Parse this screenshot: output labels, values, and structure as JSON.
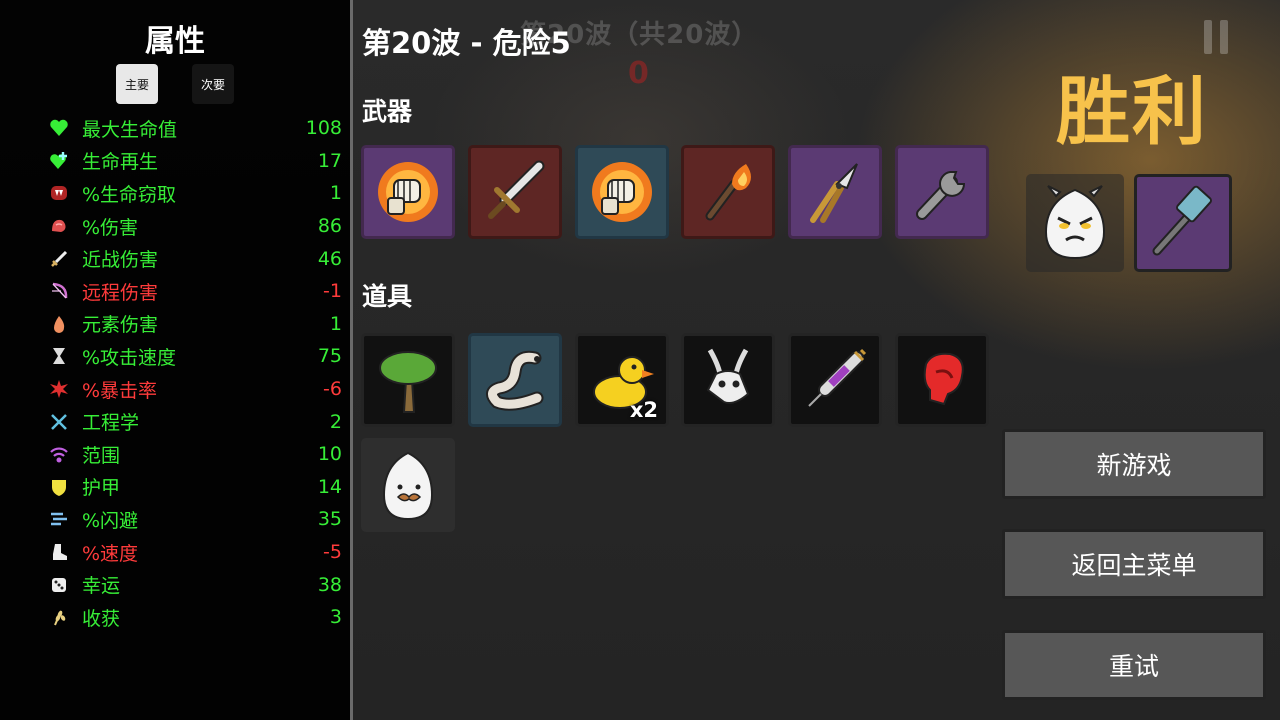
{
  "background": {
    "ghost_text": "第20波（共20波）",
    "ghost_number": "0"
  },
  "stats": {
    "title": "属性",
    "tabs": [
      {
        "label": "主要"
      },
      {
        "label": "次要"
      }
    ],
    "items": [
      {
        "label": "最大生命值",
        "value": "108",
        "tone": "pos",
        "icon": "heart-icon",
        "color": "#37ee37"
      },
      {
        "label": "生命再生",
        "value": "17",
        "tone": "pos",
        "icon": "heart-plus-icon",
        "color": "#37ee37"
      },
      {
        "label": "%生命窃取",
        "value": "1",
        "tone": "pos",
        "icon": "fangs-icon",
        "color": "#d03030"
      },
      {
        "label": "%伤害",
        "value": "86",
        "tone": "pos",
        "icon": "muscle-icon",
        "color": "#e05050"
      },
      {
        "label": "近战伤害",
        "value": "46",
        "tone": "pos",
        "icon": "sword-icon",
        "color": "#e8d8a0"
      },
      {
        "label": "远程伤害",
        "value": "-1",
        "tone": "neg",
        "icon": "bow-icon",
        "color": "#d070d0"
      },
      {
        "label": "元素伤害",
        "value": "1",
        "tone": "pos",
        "icon": "flame-icon",
        "color": "#f09060"
      },
      {
        "label": "%攻击速度",
        "value": "75",
        "tone": "pos",
        "icon": "hourglass-icon",
        "color": "#dddddd"
      },
      {
        "label": "%暴击率",
        "value": "-6",
        "tone": "neg",
        "icon": "crit-icon",
        "color": "#e03030"
      },
      {
        "label": "工程学",
        "value": "2",
        "tone": "pos",
        "icon": "crossed-tools-icon",
        "color": "#60c0e0"
      },
      {
        "label": "范围",
        "value": "10",
        "tone": "pos",
        "icon": "range-icon",
        "color": "#c060e0"
      },
      {
        "label": "护甲",
        "value": "14",
        "tone": "pos",
        "icon": "shield-icon",
        "color": "#f0e040"
      },
      {
        "label": "%闪避",
        "value": "35",
        "tone": "pos",
        "icon": "dash-icon",
        "color": "#80c0f0"
      },
      {
        "label": "%速度",
        "value": "-5",
        "tone": "neg",
        "icon": "boot-icon",
        "color": "#eeeeee"
      },
      {
        "label": "幸运",
        "value": "38",
        "tone": "pos",
        "icon": "dice-icon",
        "color": "#eeeeee"
      },
      {
        "label": "收获",
        "value": "3",
        "tone": "pos",
        "icon": "wheat-icon",
        "color": "#e8d080"
      }
    ]
  },
  "main": {
    "wave_title": "第20波 - 危险5",
    "weapons_label": "武器",
    "items_label": "道具",
    "weapons": [
      {
        "name": "fiery-fist-icon",
        "tier": "purple"
      },
      {
        "name": "sword-icon",
        "tier": "red"
      },
      {
        "name": "fiery-fist-icon",
        "tier": "blue"
      },
      {
        "name": "torch-icon",
        "tier": "red"
      },
      {
        "name": "pruner-icon",
        "tier": "purple"
      },
      {
        "name": "wrench-icon",
        "tier": "purple"
      }
    ],
    "items": [
      {
        "name": "tree-icon",
        "tier": "black"
      },
      {
        "name": "worm-icon",
        "tier": "blue"
      },
      {
        "name": "rubber-duck-icon",
        "tier": "black",
        "qty": "x2"
      },
      {
        "name": "goat-skull-icon",
        "tier": "black"
      },
      {
        "name": "syringe-icon",
        "tier": "black"
      },
      {
        "name": "boxing-glove-icon",
        "tier": "black"
      },
      {
        "name": "mustache-egg-icon",
        "tier": "none"
      }
    ]
  },
  "result": {
    "title": "胜利",
    "character": "angry-egg-icon",
    "character_weapon": "hammer-icon"
  },
  "buttons": {
    "new_game": "新游戏",
    "main_menu": "返回主菜单",
    "retry": "重试"
  }
}
